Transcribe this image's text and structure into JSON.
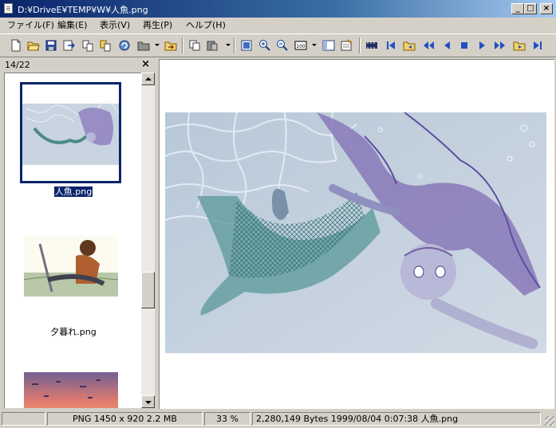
{
  "window": {
    "title": "D:¥DriveE¥TEMP¥W¥人魚.png"
  },
  "caption_buttons": {
    "minimize": "_",
    "maximize": "□",
    "close": "×"
  },
  "menu": [
    "ファイル(F)",
    "編集(E)",
    "表示(V)",
    "再生(P)",
    "ヘルプ(H)"
  ],
  "toolbar": {
    "icons": [
      "new-icon",
      "open-folder-icon",
      "save-icon",
      "export-icon",
      "copy-file-icon",
      "move-file-icon",
      "refresh-icon",
      "folder-icon",
      "goto-folder-icon",
      "copy-icon",
      "paste-icon",
      "fit-window-icon",
      "zoom-in-icon",
      "zoom-out-icon",
      "actual-size-icon",
      "thumbnail-view-icon",
      "properties-icon",
      "filmstrip-icon",
      "first-icon",
      "open-icon",
      "prev-fast-icon",
      "prev-icon",
      "stop-icon",
      "play-icon",
      "next-fast-icon",
      "next-folder-icon",
      "last-icon"
    ],
    "zoom_badge": "100"
  },
  "thumbs": {
    "counter": "14/22",
    "close": "×",
    "items": [
      {
        "label": "人魚.png",
        "selected": true
      },
      {
        "label": "夕暮れ.png",
        "selected": false
      },
      {
        "label": "",
        "selected": false
      }
    ]
  },
  "status": {
    "blank": "",
    "format": "PNG  1450 x 920  2.2 MB",
    "zoom": "33 %",
    "fileinfo": "2,280,149 Bytes  1999/08/04 0:07:38  人魚.png"
  },
  "colors": {
    "title_active": "#0a246a",
    "selection": "#0a246a",
    "face": "#d4d0c8"
  }
}
